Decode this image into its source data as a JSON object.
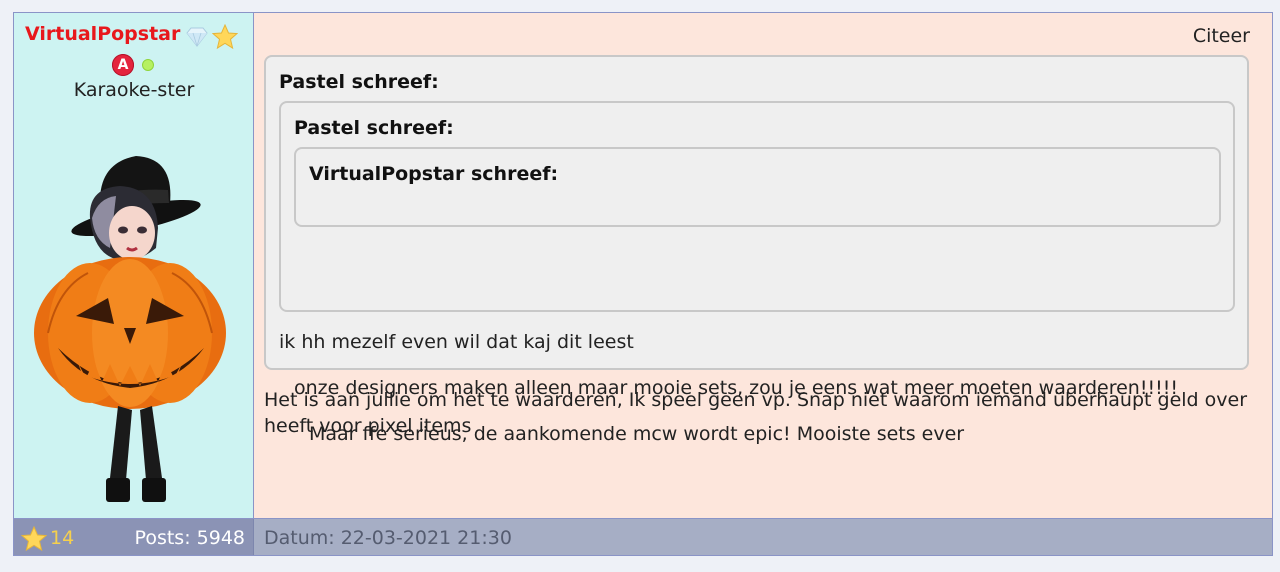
{
  "user": {
    "name": "VirtualPopstar",
    "rank": "Karaoke-ster",
    "badge_letter": "A",
    "stars": "14",
    "posts": "Posts: 5948"
  },
  "post": {
    "quote_label": "Citeer",
    "quote_outer": {
      "author": "Pastel schreef:",
      "text": "ik hh mezelf even wil dat kaj dit leest"
    },
    "quote_middle": {
      "author": "Pastel schreef:",
      "text": "onze designers maken alleen maar mooie sets, zou je eens wat meer moeten waarderen!!!!!"
    },
    "quote_inner": {
      "author": "VirtualPopstar schreef:",
      "text": "Maar ffe serieus, de aankomende mcw wordt epic! Mooiste sets ever"
    },
    "body": "Het is aan jullie om het te waarderen, Ik speel geen vp. Snap niet waarom iemand überhaupt geld over heeft voor pixel items",
    "date": "Datum: 22-03-2021 21:30"
  },
  "colors": {
    "username": "#e8181c",
    "user_panel_bg": "#cdf3f2",
    "post_bg": "#fde6dc",
    "quote_bg": "#efefef",
    "footer_bg": "#a6aec5",
    "star_count": "#f6d04d"
  },
  "icons": [
    "diamond-icon",
    "star-icon",
    "badge-icon",
    "online-dot",
    "avatar-pumpkin"
  ]
}
